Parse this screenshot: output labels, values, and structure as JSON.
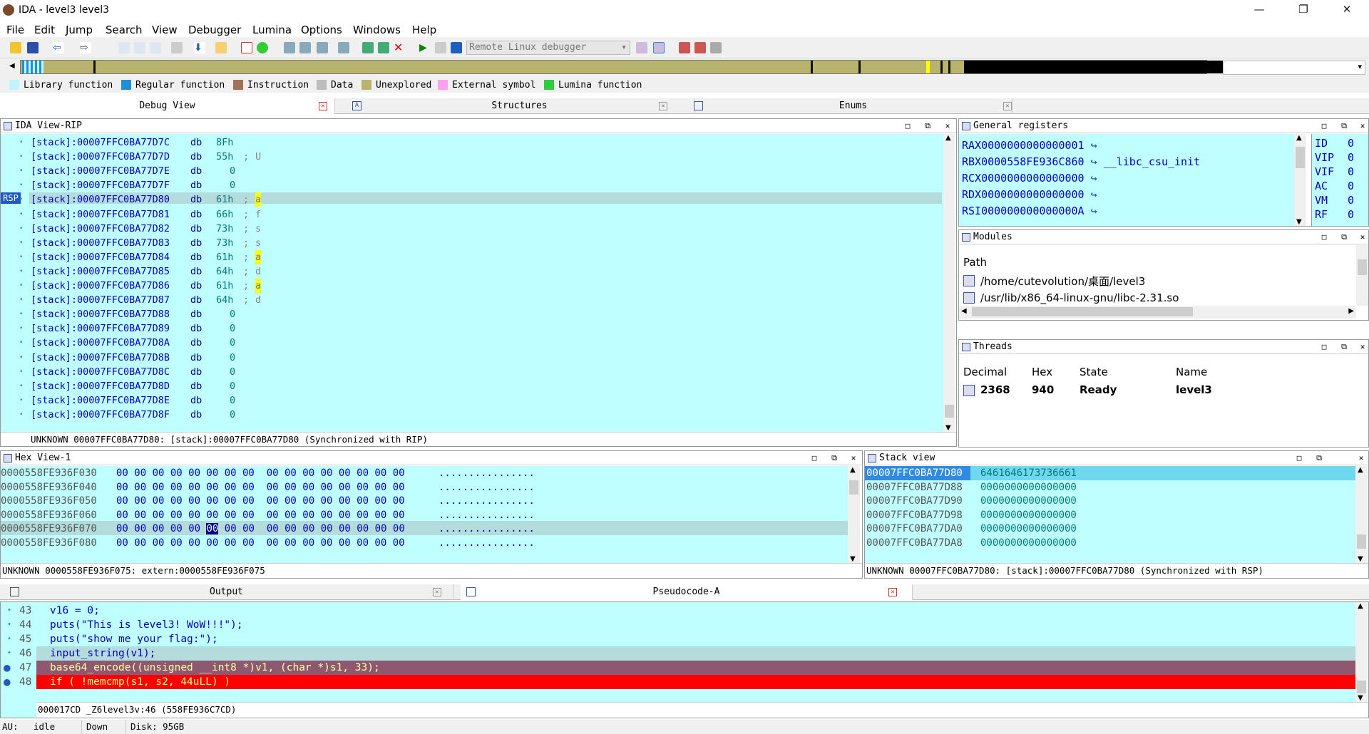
{
  "window": {
    "title": "IDA - level3 level3",
    "controls": [
      "—",
      "❐",
      "✕"
    ]
  },
  "menu": [
    "File",
    "Edit",
    "Jump",
    "Search",
    "View",
    "Debugger",
    "Lumina",
    "Options",
    "Windows",
    "Help"
  ],
  "toolbar": {
    "debugger_select": "Remote Linux debugger"
  },
  "legend": [
    {
      "label": "Library function",
      "color": "#bff5ff"
    },
    {
      "label": "Regular function",
      "color": "#1e90d8"
    },
    {
      "label": "Instruction",
      "color": "#a57058"
    },
    {
      "label": "Data",
      "color": "#bdbdbd"
    },
    {
      "label": "Unexplored",
      "color": "#b8b46e"
    },
    {
      "label": "External symbol",
      "color": "#ffa0f0"
    },
    {
      "label": "Lumina function",
      "color": "#2ecc40"
    }
  ],
  "top_tabs": [
    "Debug View",
    "Structures",
    "Enums"
  ],
  "ida_view": {
    "title": "IDA View-RIP",
    "rsp_label": "RSP",
    "lines": [
      {
        "addr": "[stack]:00007FFC0BA77D7C",
        "op": "db",
        "val": "8Fh",
        "cmt": ""
      },
      {
        "addr": "[stack]:00007FFC0BA77D7D",
        "op": "db",
        "val": "55h",
        "cmt": "U"
      },
      {
        "addr": "[stack]:00007FFC0BA77D7E",
        "op": "db",
        "val": "0",
        "cmt": ""
      },
      {
        "addr": "[stack]:00007FFC0BA77D7F",
        "op": "db",
        "val": "0",
        "cmt": ""
      },
      {
        "addr": "[stack]:00007FFC0BA77D80",
        "op": "db",
        "val": "61h",
        "cmt": "a"
      },
      {
        "addr": "[stack]:00007FFC0BA77D81",
        "op": "db",
        "val": "66h",
        "cmt": "f"
      },
      {
        "addr": "[stack]:00007FFC0BA77D82",
        "op": "db",
        "val": "73h",
        "cmt": "s"
      },
      {
        "addr": "[stack]:00007FFC0BA77D83",
        "op": "db",
        "val": "73h",
        "cmt": "s"
      },
      {
        "addr": "[stack]:00007FFC0BA77D84",
        "op": "db",
        "val": "61h",
        "cmt": "a"
      },
      {
        "addr": "[stack]:00007FFC0BA77D85",
        "op": "db",
        "val": "64h",
        "cmt": "d"
      },
      {
        "addr": "[stack]:00007FFC0BA77D86",
        "op": "db",
        "val": "61h",
        "cmt": "a"
      },
      {
        "addr": "[stack]:00007FFC0BA77D87",
        "op": "db",
        "val": "64h",
        "cmt": "d"
      },
      {
        "addr": "[stack]:00007FFC0BA77D88",
        "op": "db",
        "val": "0",
        "cmt": ""
      },
      {
        "addr": "[stack]:00007FFC0BA77D89",
        "op": "db",
        "val": "0",
        "cmt": ""
      },
      {
        "addr": "[stack]:00007FFC0BA77D8A",
        "op": "db",
        "val": "0",
        "cmt": ""
      },
      {
        "addr": "[stack]:00007FFC0BA77D8B",
        "op": "db",
        "val": "0",
        "cmt": ""
      },
      {
        "addr": "[stack]:00007FFC0BA77D8C",
        "op": "db",
        "val": "0",
        "cmt": ""
      },
      {
        "addr": "[stack]:00007FFC0BA77D8D",
        "op": "db",
        "val": "0",
        "cmt": ""
      },
      {
        "addr": "[stack]:00007FFC0BA77D8E",
        "op": "db",
        "val": "0",
        "cmt": ""
      },
      {
        "addr": "[stack]:00007FFC0BA77D8F",
        "op": "db",
        "val": "0",
        "cmt": ""
      }
    ],
    "status": "UNKNOWN 00007FFC0BA77D80: [stack]:00007FFC0BA77D80 (Synchronized with RIP)"
  },
  "registers": {
    "title": "General registers",
    "rows": [
      {
        "name": "RAX",
        "val": "0000000000000001",
        "sym": ""
      },
      {
        "name": "RBX",
        "val": "0000558FE936C860",
        "sym": "__libc_csu_init"
      },
      {
        "name": "RCX",
        "val": "0000000000000000",
        "sym": ""
      },
      {
        "name": "RDX",
        "val": "0000000000000000",
        "sym": ""
      },
      {
        "name": "RSI",
        "val": "000000000000000A",
        "sym": ""
      }
    ],
    "flags": [
      {
        "name": "ID",
        "val": "0"
      },
      {
        "name": "VIP",
        "val": "0"
      },
      {
        "name": "VIF",
        "val": "0"
      },
      {
        "name": "AC",
        "val": "0"
      },
      {
        "name": "VM",
        "val": "0"
      },
      {
        "name": "RF",
        "val": "0"
      }
    ]
  },
  "modules": {
    "title": "Modules",
    "col": "Path",
    "rows": [
      "/home/cutevolution/桌面/level3",
      "/usr/lib/x86_64-linux-gnu/libc-2.31.so"
    ]
  },
  "threads": {
    "title": "Threads",
    "cols": [
      "Decimal",
      "Hex",
      "State",
      "Name"
    ],
    "row": {
      "decimal": "2368",
      "hex": "940",
      "state": "Ready",
      "name": "level3"
    }
  },
  "hex_view": {
    "title": "Hex View-1",
    "rows": [
      {
        "addr": "0000558FE936F030",
        "bytes": "00 00 00 00 00 00 00 00  00 00 00 00 00 00 00 00",
        "ascii": "................"
      },
      {
        "addr": "0000558FE936F040",
        "bytes": "00 00 00 00 00 00 00 00  00 00 00 00 00 00 00 00",
        "ascii": "................"
      },
      {
        "addr": "0000558FE936F050",
        "bytes": "00 00 00 00 00 00 00 00  00 00 00 00 00 00 00 00",
        "ascii": "................"
      },
      {
        "addr": "0000558FE936F060",
        "bytes": "00 00 00 00 00 00 00 00  00 00 00 00 00 00 00 00",
        "ascii": "................"
      },
      {
        "addr": "0000558FE936F070",
        "bytes": "00 00 00 00 00 00 00 00  00 00 00 00 00 00 00 00",
        "ascii": "................"
      },
      {
        "addr": "0000558FE936F080",
        "bytes": "00 00 00 00 00 00 00 00  00 00 00 00 00 00 00 00",
        "ascii": "................"
      }
    ],
    "status": "UNKNOWN 0000558FE936F075: extern:0000558FE936F075"
  },
  "stack_view": {
    "title": "Stack view",
    "rows": [
      {
        "addr": "00007FFC0BA77D80",
        "val": "6461646173736661"
      },
      {
        "addr": "00007FFC0BA77D88",
        "val": "0000000000000000"
      },
      {
        "addr": "00007FFC0BA77D90",
        "val": "0000000000000000"
      },
      {
        "addr": "00007FFC0BA77D98",
        "val": "0000000000000000"
      },
      {
        "addr": "00007FFC0BA77DA0",
        "val": "0000000000000000"
      },
      {
        "addr": "00007FFC0BA77DA8",
        "val": "0000000000000000"
      }
    ],
    "status": "UNKNOWN 00007FFC0BA77D80: [stack]:00007FFC0BA77D80 (Synchronized with RSP)"
  },
  "bottom_tabs": [
    "Output",
    "Pseudocode-A"
  ],
  "pseudocode": {
    "lines": [
      {
        "num": "43",
        "code": "v16 = 0;"
      },
      {
        "num": "44",
        "code": "puts(\"This is level3! WoW!!!\");"
      },
      {
        "num": "45",
        "code": "puts(\"show me your flag:\");"
      },
      {
        "num": "46",
        "code": "input_string(v1);"
      },
      {
        "num": "47",
        "code": "base64_encode((unsigned __int8 *)v1, (char *)s1, 33);"
      },
      {
        "num": "48",
        "code": "if ( !memcmp(s1, s2, 44uLL) )"
      }
    ],
    "status": "000017CD _Z6level3v:46 (558FE936C7CD)"
  },
  "statusbar": {
    "au": "AU:",
    "state": "idle",
    "dir": "Down",
    "disk": "Disk: 95GB"
  }
}
